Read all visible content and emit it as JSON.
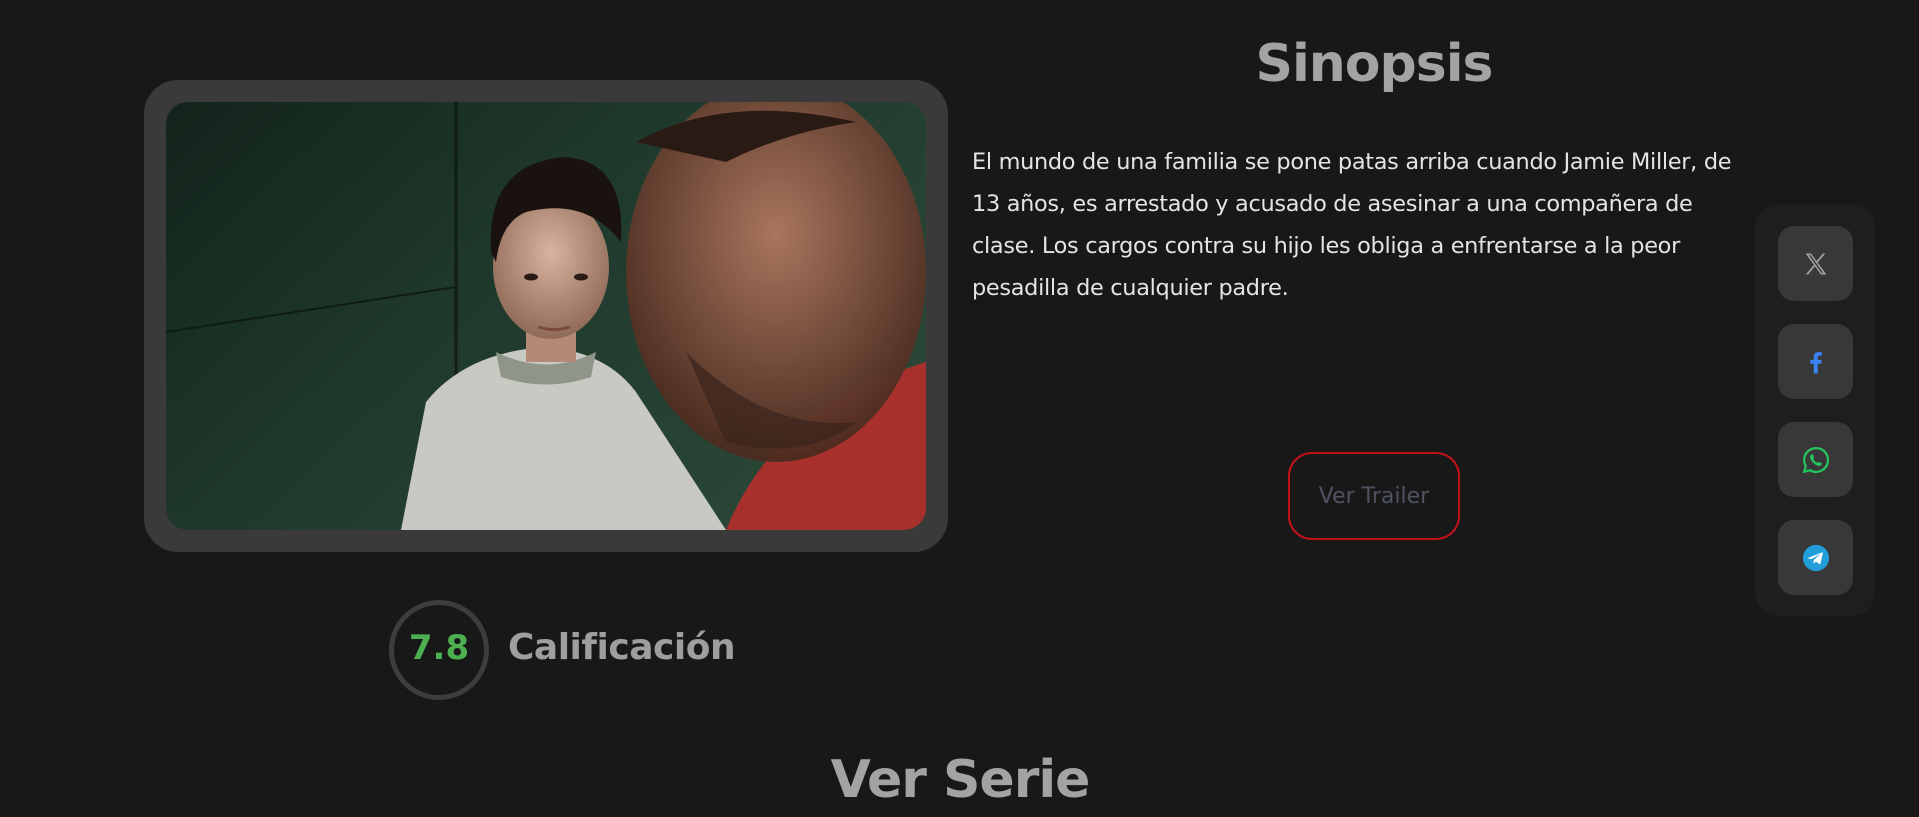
{
  "poster": {
    "alt": "Jamie Miller y su padre"
  },
  "rating": {
    "value": "7.8",
    "label": "Calificación",
    "value_color": "#4caf50"
  },
  "synopsis": {
    "title": "Sinopsis",
    "text": "El mundo de una familia se pone patas arriba cuando Jamie Miller, de 13 años, es arrestado y acusado de asesinar a una compañera de clase. Los cargos contra su hijo les obliga a enfrentarse a la peor pesadilla de cualquier padre."
  },
  "trailer": {
    "label": "Ver Trailer",
    "border_color": "#c1121a"
  },
  "share": {
    "buttons": [
      {
        "icon": "x-icon",
        "color": "#9e9e9e"
      },
      {
        "icon": "facebook-icon",
        "color": "#3b82f6"
      },
      {
        "icon": "whatsapp-icon",
        "color": "#22c55e"
      },
      {
        "icon": "telegram-icon",
        "color": "#229ed9"
      }
    ]
  },
  "section": {
    "title": "Ver Serie"
  }
}
